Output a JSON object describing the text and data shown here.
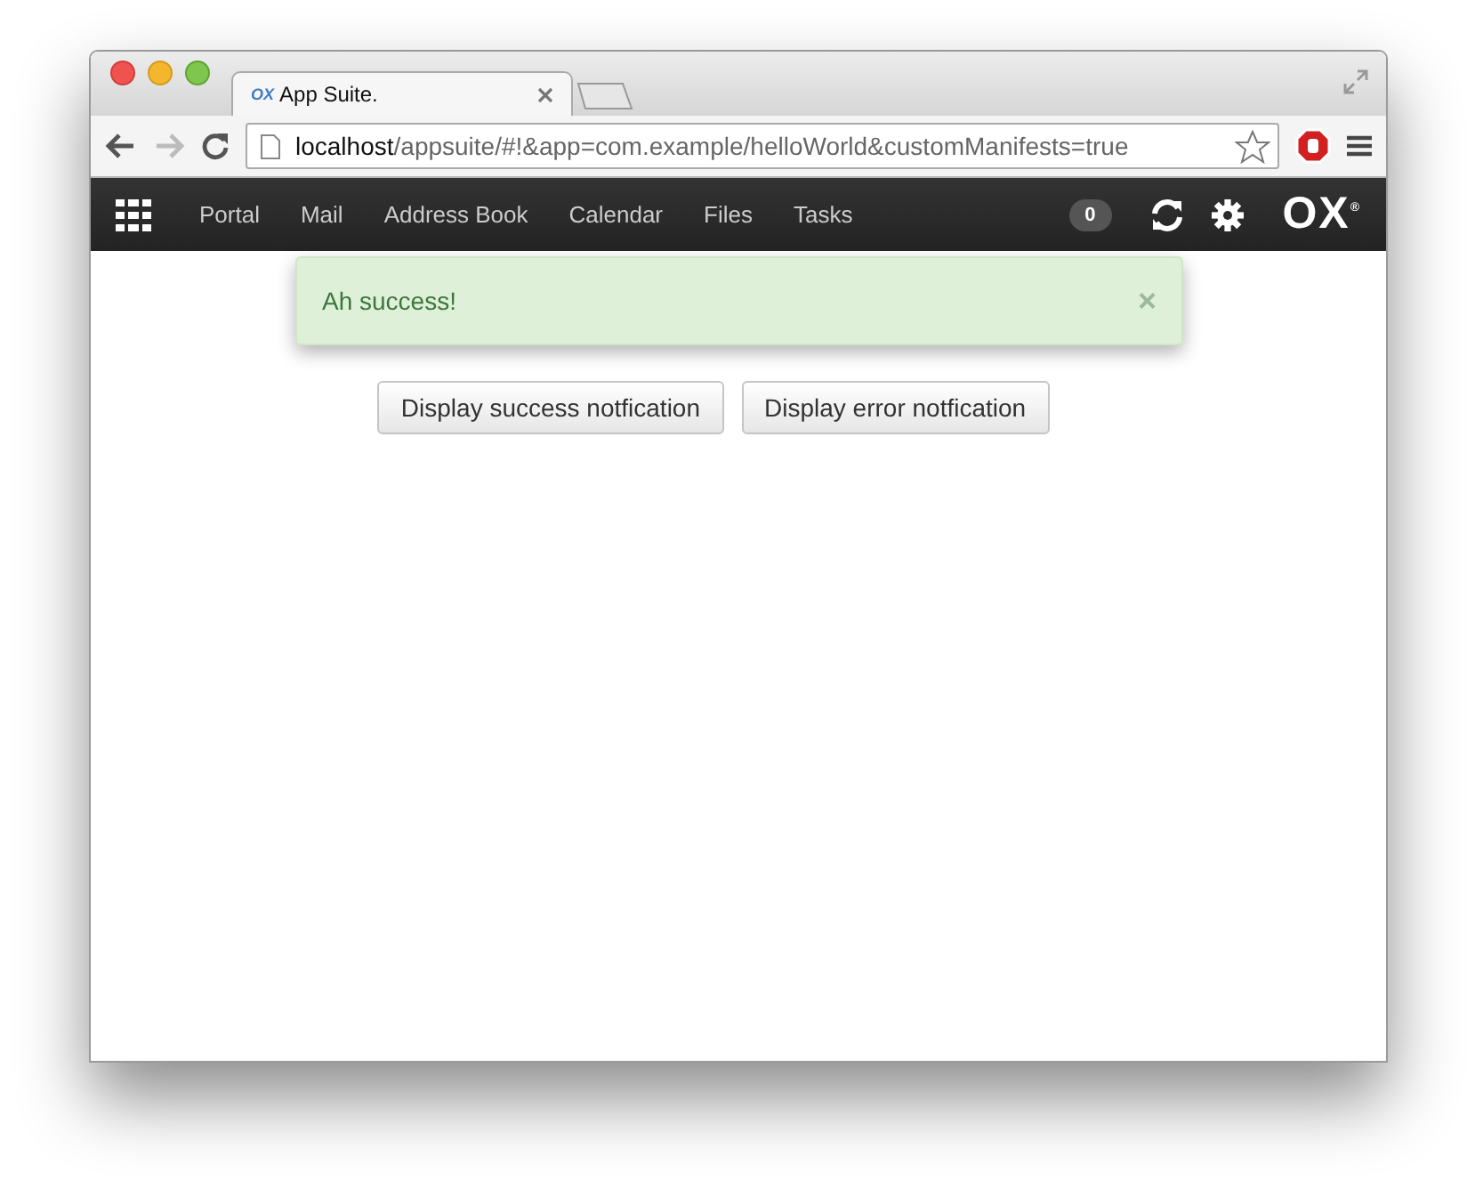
{
  "browser": {
    "tabs": [
      {
        "logo": "OX",
        "title": "App Suite.",
        "selected": true
      }
    ],
    "address": {
      "host": "localhost",
      "path": "/appsuite/#!&app=com.example/helloWorld&customManifests=true"
    }
  },
  "navbar": {
    "items": [
      {
        "label": "Portal"
      },
      {
        "label": "Mail"
      },
      {
        "label": "Address Book"
      },
      {
        "label": "Calendar"
      },
      {
        "label": "Files"
      },
      {
        "label": "Tasks"
      }
    ],
    "badge": "0",
    "logo": "OX",
    "logo_mark": "®"
  },
  "notification": {
    "message": "Ah success!",
    "close": "×"
  },
  "buttons": [
    "Display success notfication",
    "Display error notfication"
  ]
}
